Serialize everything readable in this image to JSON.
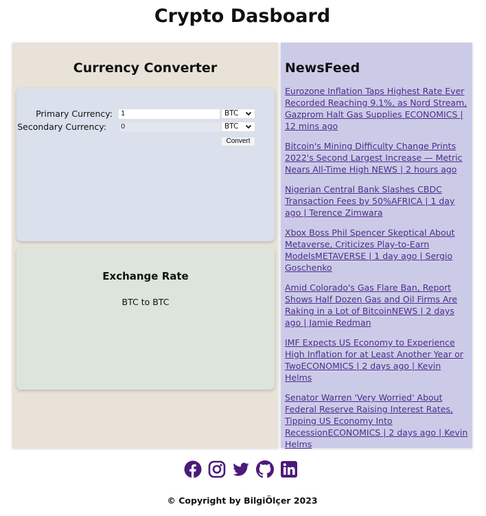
{
  "page": {
    "title": "Crypto Dasboard"
  },
  "converter": {
    "title": "Currency Converter",
    "primary_label": "Primary Currency:",
    "primary_value": "1",
    "primary_currency": "BTC",
    "secondary_label": "Secondary Currency:",
    "secondary_value": "0",
    "secondary_currency": "BTC",
    "convert_label": "Convert"
  },
  "exchange": {
    "title": "Exchange Rate",
    "text": "BTC to BTC"
  },
  "news": {
    "title": "NewsFeed",
    "items": [
      {
        "text": "Eurozone Inflation Taps Highest Rate Ever Recorded Reaching 9.1%, as Nord Stream, Gazprom Halt Gas Supplies ECONOMICS | 12 mins ago"
      },
      {
        "text": "Bitcoin's Mining Difficulty Change Prints 2022's Second Largest Increase — Metric Nears All-Time High NEWS | 2 hours ago"
      },
      {
        "text": "Nigerian Central Bank Slashes CBDC Transaction Fees by 50%AFRICA | 1 day ago | Terence Zimwara"
      },
      {
        "text": "Xbox Boss Phil Spencer Skeptical About Metaverse, Criticizes Play-to-Earn ModelsMETAVERSE | 1 day ago | Sergio Goschenko"
      },
      {
        "text": "Amid Colorado's Gas Flare Ban, Report Shows Half Dozen Gas and Oil Firms Are Raking in a Lot of BitcoinNEWS | 2 days ago | Jamie Redman"
      },
      {
        "text": "IMF Expects US Economy to Experience High Inflation for at Least Another Year or TwoECONOMICS | 2 days ago | Kevin Helms"
      },
      {
        "text": "Senator Warren 'Very Worried' About Federal Reserve Raising Interest Rates, Tipping US Economy Into RecessionECONOMICS | 2 days ago | Kevin Helms"
      }
    ]
  },
  "footer": {
    "icons": [
      "facebook-icon",
      "instagram-icon",
      "twitter-icon",
      "github-icon",
      "linkedin-icon"
    ],
    "icon_color": "#4b1a7a",
    "copyright": "© Copyright by BilgiÖlçer 2023"
  },
  "colors": {
    "left_panel": "#e8e2d8",
    "right_panel": "#cccbe7",
    "converter_card": "#dae0ec",
    "rate_card": "#dde4dc",
    "link": "#4b2d8e"
  }
}
